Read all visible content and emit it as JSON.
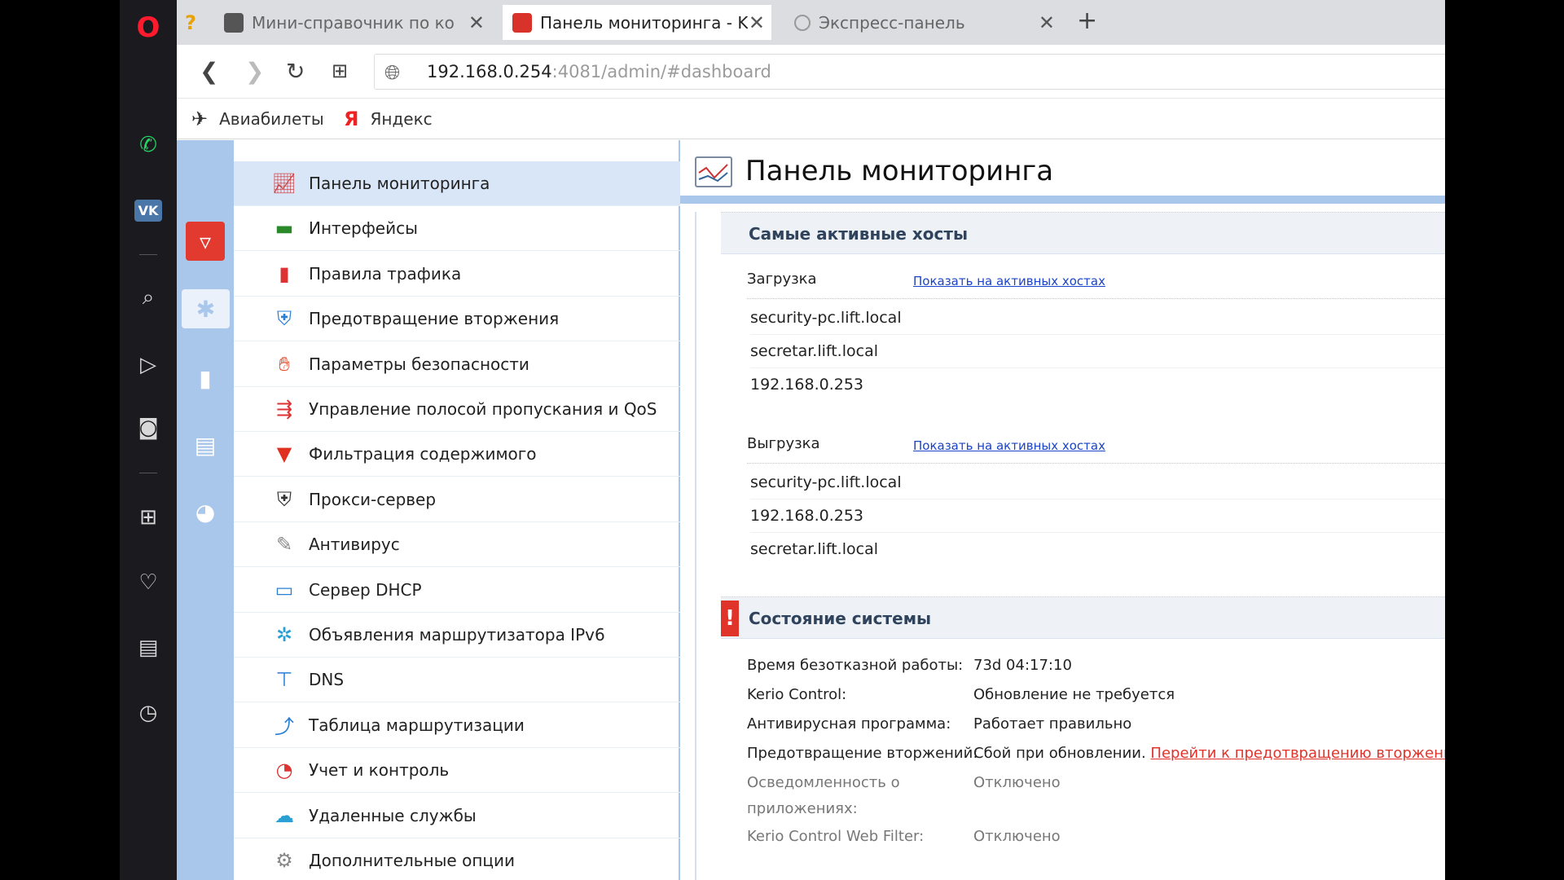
{
  "tabs": [
    {
      "title": "Мини-справочник по ко",
      "active": false
    },
    {
      "title": "Панель мониторинга - Ke",
      "active": true
    },
    {
      "title": "Экспресс-панель",
      "active": false
    }
  ],
  "address": {
    "host": "192.168.0.254",
    "rest": ":4081/admin/#dashboard"
  },
  "bookmarks": [
    {
      "label": "Авиабилеты",
      "icon": "plane-icon"
    },
    {
      "label": "Яндекс",
      "icon": "yandex-icon"
    }
  ],
  "menu": [
    {
      "label": "Панель мониторинга",
      "icon": "monitoring-icon",
      "active": true
    },
    {
      "label": "Интерфейсы",
      "icon": "interfaces-icon"
    },
    {
      "label": "Правила трафика",
      "icon": "traffic-rules-icon"
    },
    {
      "label": "Предотвращение вторжения",
      "icon": "shield-icon"
    },
    {
      "label": "Параметры безопасности",
      "icon": "hand-icon"
    },
    {
      "label": "Управление полосой пропускания и QoS",
      "icon": "bandwidth-icon"
    },
    {
      "label": "Фильтрация содержимого",
      "icon": "filter-icon"
    },
    {
      "label": "Прокси-сервер",
      "icon": "proxy-icon"
    },
    {
      "label": "Антивирус",
      "icon": "antivirus-icon"
    },
    {
      "label": "Сервер DHCP",
      "icon": "dhcp-icon"
    },
    {
      "label": "Объявления маршрутизатора IPv6",
      "icon": "ipv6-icon"
    },
    {
      "label": "DNS",
      "icon": "dns-icon"
    },
    {
      "label": "Таблица маршрутизации",
      "icon": "routing-icon"
    },
    {
      "label": "Учет и контроль",
      "icon": "accounting-icon"
    },
    {
      "label": "Удаленные службы",
      "icon": "cloud-icon"
    },
    {
      "label": "Дополнительные опции",
      "icon": "advanced-options-icon"
    }
  ],
  "content": {
    "title": "Панель мониторинга",
    "top_hosts": {
      "heading": "Самые активные хосты",
      "download_label": "Загрузка",
      "download_link": "Показать на активных хостах",
      "download_hosts": [
        "security-pc.lift.local",
        "secretar.lift.local",
        "192.168.0.253"
      ],
      "upload_label": "Выгрузка",
      "upload_link": "Показать на активных хостах",
      "upload_hosts": [
        "security-pc.lift.local",
        "192.168.0.253",
        "secretar.lift.local"
      ]
    },
    "system_status": {
      "heading": "Состояние системы",
      "uptime_label": "Время безотказной работы:",
      "uptime_value": "73d 04:17:10",
      "kerio_label": "Kerio Control:",
      "kerio_value": "Обновление не требуется",
      "antivirus_label": "Антивирусная программа:",
      "antivirus_value": "Работает правильно",
      "ips_label": "Предотвращение вторжений:",
      "ips_value": "Сбой при обновлении.",
      "ips_link": "Перейти к предотвращению вторжения",
      "app_awareness_label_1": "Осведомленность о",
      "app_awareness_label_2": "приложениях:",
      "app_awareness_value": "Отключено",
      "webfilter_label": "Kerio Control Web Filter:",
      "webfilter_value": "Отключено"
    }
  }
}
